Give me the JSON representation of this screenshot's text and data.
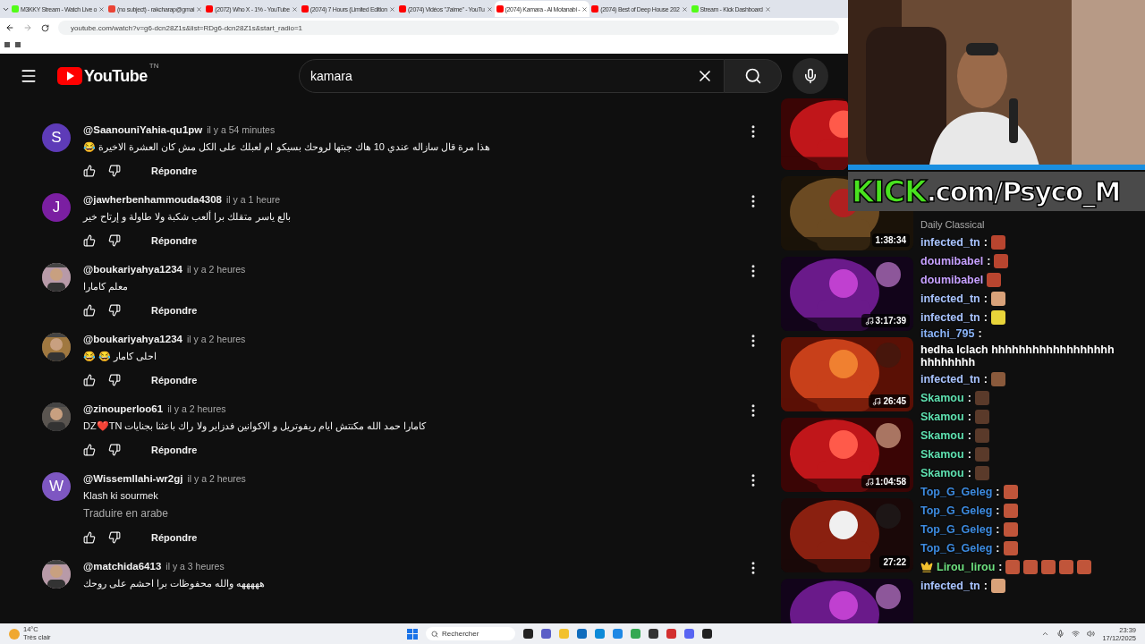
{
  "browser": {
    "tabs": [
      {
        "label": "M3KKY Stream - Watch Live o",
        "color": "#53fc18",
        "selected": false
      },
      {
        "label": "(no subject) - rakcharap@gmai",
        "color": "#ea4335",
        "selected": false
      },
      {
        "label": "(2072) Who X - 1% - YouTube",
        "color": "#ff0000",
        "selected": false
      },
      {
        "label": "(2074) 7 Hours (Limited Edition",
        "color": "#ff0000",
        "selected": false
      },
      {
        "label": "(2074) Vidéos \"J'aime\" - YouTu",
        "color": "#ff0000",
        "selected": false
      },
      {
        "label": "(2074) Kamara - Al Motanabi -",
        "color": "#ff0000",
        "selected": true
      },
      {
        "label": "(2074) Best of Deep House 202",
        "color": "#ff0000",
        "selected": false
      },
      {
        "label": "Stream - Kick Dashboard",
        "color": "#53fc18",
        "selected": false
      }
    ],
    "address": "youtube.com/watch?v=g6-dcn28Z1s&list=RDg6-dcn28Z1s&start_radio=1"
  },
  "header": {
    "logo": "YouTube",
    "country": "TN",
    "search": {
      "value": "kamara"
    }
  },
  "comments": [
    {
      "author": "@SaanouniYahia-qu1pw",
      "time": "il y a 54 minutes",
      "text": "هذا مرة قال سازاله عندي 10 هاك جبتها لروحك بسيكو ام لعبلك على الكل مش كان العشرة الاخيرة 😂",
      "avatar": {
        "kind": "letter",
        "letter": "S",
        "color": "#5e3bb8"
      },
      "reply": "Répondre"
    },
    {
      "author": "@jawherbenhammouda4308",
      "time": "il y a 1 heure",
      "text": "بالع ياسر متقلك برا ألعب شكبة ولا طاولة و إرتاح خير",
      "avatar": {
        "kind": "letter",
        "letter": "J",
        "color": "#7b1fa2"
      },
      "reply": "Répondre"
    },
    {
      "author": "@boukariyahya1234",
      "time": "il y a 2 heures",
      "text": "معلم كامارا",
      "reply": "Répondre"
    },
    {
      "author": "@boukariyahya1234",
      "time": "il y a 2 heures",
      "text": "احلى كامار 😂 😂",
      "reply": "Répondre"
    },
    {
      "author": "@zinouperloo61",
      "time": "il y a 2 heures",
      "text": "كامارا حمد الله مكنتش ايام ريفوتريل و الاكوانين فدزاير ولا راك باعثنا بجنايات DZ❤️TN",
      "reply": "Répondre"
    },
    {
      "author": "@Wissemllahi-wr2gj",
      "time": "il y a 2 heures",
      "text": "Klash  ki sourmek",
      "translate": "Traduire en arabe",
      "avatar": {
        "kind": "letter",
        "letter": "W",
        "color": "#7e57c2"
      },
      "reply": "Répondre"
    },
    {
      "author": "@matchida6413",
      "time": "il y a 3 heures",
      "text": "هههههه والله محفوظات برا احشم على روحك"
    }
  ],
  "recommendations": [
    {
      "kind": "red"
    },
    {
      "kind": "classic",
      "duration": "1:38:34",
      "music": false,
      "channel": "Daily Classical"
    },
    {
      "kind": "purple",
      "duration": "3:17:39",
      "music": true
    },
    {
      "kind": "autumn",
      "duration": "26:45",
      "music": true
    },
    {
      "kind": "red",
      "duration": "1:04:58",
      "music": true
    },
    {
      "kind": "reaction",
      "duration": "27:22",
      "music": false
    },
    {
      "kind": "purple"
    }
  ],
  "stream": {
    "banner": {
      "brand": "KICK",
      "url": ".com/Psyco_M"
    },
    "chat": [
      {
        "user": "infected_tn",
        "sep": ":",
        "color": "#a9c4ff",
        "emotes": [
          {
            "color": "#b8452f"
          }
        ]
      },
      {
        "user": "doumibabel",
        "sep": ":",
        "color": "#c6a0ff",
        "emotes": [
          {
            "color": "#b8452f"
          }
        ]
      },
      {
        "user": "doumibabel",
        "color": "#c6a0ff",
        "emotes": [
          {
            "color": "#b8452f"
          }
        ]
      },
      {
        "user": "infected_tn",
        "sep": ":",
        "color": "#a9c4ff",
        "emotes": [
          {
            "color": "#d9a27a"
          }
        ]
      },
      {
        "user": "infected_tn",
        "sep": ":",
        "color": "#a9c4ff",
        "emotes": [
          {
            "color": "#e8d43a"
          }
        ]
      },
      {
        "user": "itachi_795",
        "sep": ":",
        "color": "#8ab4f8",
        "text": "hedha lclach hhhhhhhhhhhhhhhhhhhhhhhhhh"
      },
      {
        "user": "infected_tn",
        "sep": ":",
        "color": "#a9c4ff",
        "emotes": [
          {
            "color": "#8a5a3c"
          }
        ]
      },
      {
        "user": "Skamou",
        "sep": ":",
        "color": "#5fe0b0",
        "emotes": [
          {
            "color": "#5a3a2a"
          }
        ]
      },
      {
        "user": "Skamou",
        "sep": ":",
        "color": "#5fe0b0",
        "emotes": [
          {
            "color": "#5a3a2a"
          }
        ]
      },
      {
        "user": "Skamou",
        "sep": ":",
        "color": "#5fe0b0",
        "emotes": [
          {
            "color": "#5a3a2a"
          }
        ]
      },
      {
        "user": "Skamou",
        "sep": ":",
        "color": "#5fe0b0",
        "emotes": [
          {
            "color": "#5a3a2a"
          }
        ]
      },
      {
        "user": "Skamou",
        "sep": ":",
        "color": "#5fe0b0",
        "emotes": [
          {
            "color": "#5a3a2a"
          }
        ]
      },
      {
        "user": "Top_G_Geleg",
        "sep": ":",
        "color": "#3d8be0",
        "emotes": [
          {
            "color": "#c0553a"
          }
        ]
      },
      {
        "user": "Top_G_Geleg",
        "sep": ":",
        "color": "#3d8be0",
        "emotes": [
          {
            "color": "#c0553a"
          }
        ]
      },
      {
        "user": "Top_G_Geleg",
        "sep": ":",
        "color": "#3d8be0",
        "emotes": [
          {
            "color": "#c0553a"
          }
        ]
      },
      {
        "user": "Top_G_Geleg",
        "sep": ":",
        "color": "#3d8be0",
        "emotes": [
          {
            "color": "#c0553a"
          }
        ]
      },
      {
        "user": "Lirou_lirou",
        "sep": ":",
        "color": "#6de07f",
        "crown": true,
        "emotes": [
          {
            "color": "#c0553a"
          },
          {
            "color": "#c0553a"
          },
          {
            "color": "#c0553a"
          },
          {
            "color": "#c0553a"
          },
          {
            "color": "#c0553a"
          }
        ]
      },
      {
        "user": "infected_tn",
        "sep": ":",
        "color": "#a9c4ff",
        "emotes": [
          {
            "color": "#d9a27a"
          }
        ]
      }
    ]
  },
  "taskbar": {
    "weather": {
      "temp": "14°C",
      "condition": "Très clair"
    },
    "search": {
      "placeholder": "Rechercher"
    },
    "time": "23:39",
    "date": "17/12/2025"
  }
}
